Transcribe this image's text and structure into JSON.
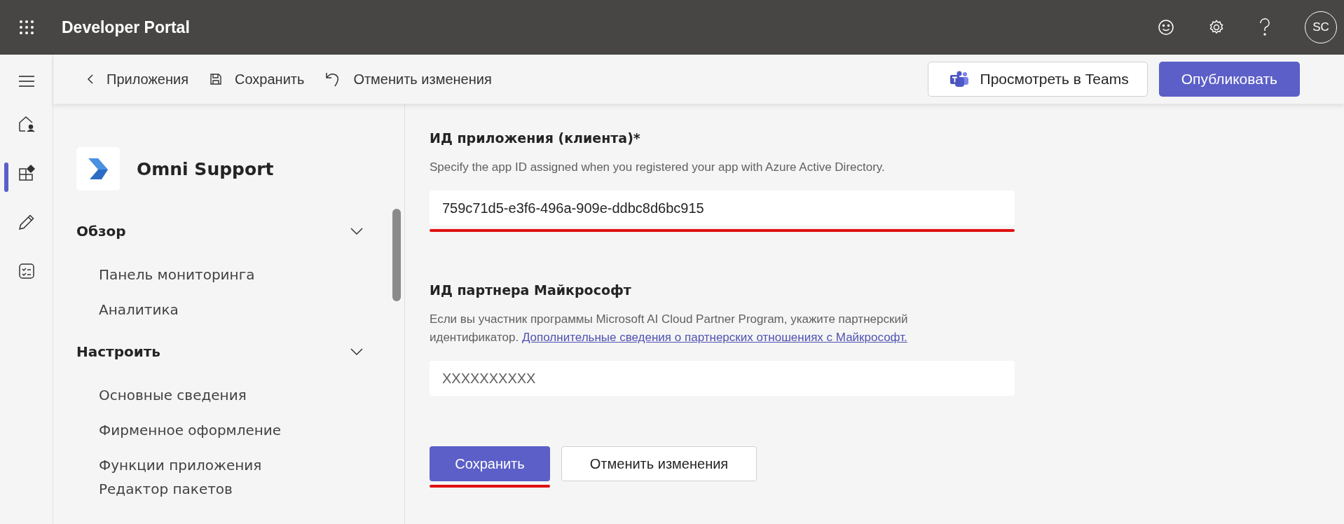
{
  "header": {
    "title": "Developer Portal",
    "avatar": "SC"
  },
  "toolbar": {
    "back": "Приложения",
    "save": "Сохранить",
    "undo": "Отменить изменения",
    "preview": "Просмотреть в Teams",
    "publish": "Опубликовать"
  },
  "rail": [
    {
      "kind": "home",
      "selected": false
    },
    {
      "kind": "apps",
      "selected": true
    },
    {
      "kind": "edit",
      "selected": false
    },
    {
      "kind": "checklist",
      "selected": false
    }
  ],
  "sidebar": {
    "app_name": "Omni Support",
    "groups": [
      {
        "label": "Обзор",
        "expanded": true,
        "children": [
          {
            "label": "Панель мониторинга"
          },
          {
            "label": "Аналитика"
          }
        ]
      },
      {
        "label": "Настроить",
        "expanded": true,
        "children": [
          {
            "label": "Основные сведения"
          },
          {
            "label": "Фирменное оформление"
          },
          {
            "label": "Функции приложения"
          },
          {
            "label": "Редактор пакетов"
          }
        ]
      }
    ]
  },
  "form": {
    "fields": [
      {
        "label": "ИД приложения (клиента)*",
        "description": "Specify the app ID assigned when you registered your app with Azure Active Directory.",
        "value": "759c71d5-e3f6-496a-909e-ddbc8d6bc915",
        "highlighted": true
      },
      {
        "label": "ИД партнера Майкрософт",
        "description": "Если вы участник программы Microsoft AI Cloud Partner Program, укажите партнерский идентификатор.",
        "link": "Дополнительные сведения о партнерских отношениях с Майкрософт.",
        "placeholder": "XXXXXXXXXX",
        "highlighted": false
      }
    ],
    "save": {
      "label": "Сохранить",
      "highlighted": true
    },
    "cancel": "Отменить изменения"
  }
}
